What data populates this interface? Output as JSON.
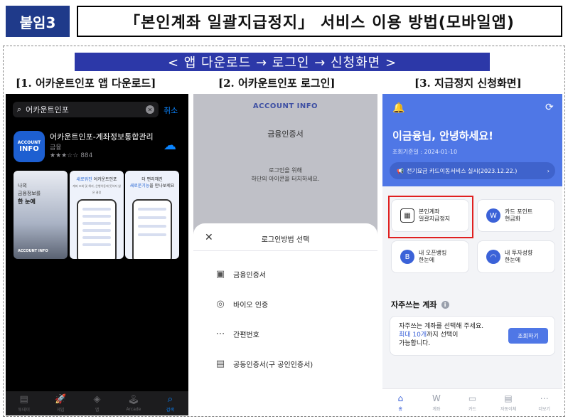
{
  "header": {
    "tag": "붙임3",
    "title": "「본인계좌 일괄지급정지」 서비스 이용 방법(모바일앱)"
  },
  "banner": "< 앱 다운로드 → 로그인 → 신청화면 >",
  "captions": {
    "step1": "[1. 어카운트인포 앱 다운로드]",
    "step2": "[2. 어카운트인포 로그인]",
    "step3": "[3. 지급정지 신청화면]"
  },
  "step1": {
    "search_value": "어카운트인포",
    "cancel": "취소",
    "app_icon_line1": "ACCOUNT",
    "app_icon_line2": "INFO",
    "app_name": "어카운트인포-계좌정보통합관리",
    "category": "금융",
    "rating": "★★★☆☆ 884",
    "shot1": {
      "l1": "나의",
      "l2": "금융정보를",
      "l3": "한 눈에",
      "footer": "ACCOUNT INFO"
    },
    "shot2": {
      "l1": "새로워진",
      "l2": "어카운트인포",
      "sub": "계좌 조회 및 해지, 은행이동에 뜻하지 않은 결정"
    },
    "shot3": {
      "l1": "더 편리해진",
      "l2": "새로운기능",
      "l3": "을 만나보세요"
    },
    "tabs": [
      {
        "icon": "▤",
        "label": "투데이"
      },
      {
        "icon": "🚀",
        "label": "게임"
      },
      {
        "icon": "◈",
        "label": "앱"
      },
      {
        "icon": "🕹",
        "label": "Arcade"
      },
      {
        "icon": "⌕",
        "label": "검색"
      }
    ]
  },
  "step2": {
    "brand": "ACCOUNT INFO",
    "cert_label": "금융인증서",
    "msg1": "로그인을 위해",
    "msg2": "하단의 아이콘을 터치하세요.",
    "sheet_title": "로그인방법 선택",
    "methods": [
      {
        "icon": "▣",
        "label": "금융인증서"
      },
      {
        "icon": "◎",
        "label": "바이오 인증"
      },
      {
        "icon": "⋯",
        "label": "간편번호"
      },
      {
        "icon": "▤",
        "label": "공동인증서(구 공인인증서)"
      }
    ]
  },
  "step3": {
    "greeting": "이금융님, 안녕하세요!",
    "date": "조회기준일 : 2024-01-10",
    "notice": "전기요금 카드이동서비스 실시(2023.12.22.)",
    "cards": [
      {
        "l1": "본인계좌",
        "l2": "일괄지급정지",
        "icon": "▦",
        "color": "#ffffff"
      },
      {
        "l1": "카드 포인트",
        "l2": "현금화",
        "icon": "W",
        "color": "#3b62d8"
      },
      {
        "l1": "내 오픈뱅킹",
        "l2": "한눈에",
        "icon": "B",
        "color": "#3b62d8"
      },
      {
        "l1": "내 투자성향",
        "l2": "한눈에",
        "icon": "◠",
        "color": "#3b62d8"
      }
    ],
    "fav_title": "자주쓰는 계좌",
    "fav_l1": "자주쓰는 계좌를 선택해 주세요.",
    "fav_l2a": "최대 10개",
    "fav_l2b": "까지 선택이",
    "fav_l3": "가능합니다.",
    "fav_button": "조회하기",
    "tabs": [
      {
        "icon": "⌂",
        "label": "홈"
      },
      {
        "icon": "W",
        "label": "계좌"
      },
      {
        "icon": "▭",
        "label": "카드"
      },
      {
        "icon": "▤",
        "label": "자동이체"
      },
      {
        "icon": "⋯",
        "label": "더보기"
      }
    ]
  }
}
